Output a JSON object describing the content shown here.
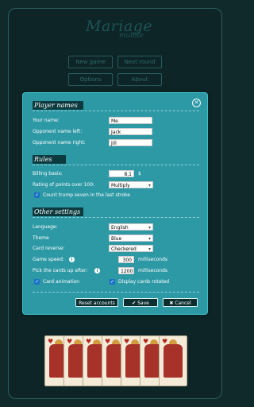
{
  "app": {
    "title": "Mariage",
    "subtitle": "mobile"
  },
  "menu": {
    "new_game": "New game",
    "next_round": "Next round",
    "options": "Options",
    "about": "About"
  },
  "dialog": {
    "close_icon": "close-icon",
    "sections": {
      "player_names": "Player names",
      "rules": "Rules",
      "other_settings": "Other settings"
    },
    "player_names": {
      "your_name_label": "Your name:",
      "your_name_value": "Me",
      "left_label": "Opponent name left:",
      "left_value": "Jack",
      "right_label": "Opponent name right:",
      "right_value": "Jill"
    },
    "rules": {
      "billing_label": "Billing basis:",
      "billing_value": "8,1",
      "billing_unit": "$",
      "rating_label": "Rating of points over 100:",
      "rating_value": "Multiply",
      "count_trump_label": "Count trump seven in the last stroke",
      "count_trump_checked": true
    },
    "other": {
      "language_label": "Language:",
      "language_value": "English",
      "theme_label": "Theme",
      "theme_value": "Blue",
      "card_reverse_label": "Card reverse:",
      "card_reverse_value": "Checkered",
      "game_speed_label": "Game speed:",
      "game_speed_value": "300",
      "game_speed_unit": "milliseconds",
      "pick_cards_label": "Pick the cards up after:",
      "pick_cards_value": "1200",
      "pick_cards_unit": "milliseconds",
      "card_animation_label": "Card animation",
      "display_rotated_label": "Display cards rotated"
    },
    "buttons": {
      "reset": "Reset accounts",
      "save": "✔ Save",
      "cancel": "✖ Cancel"
    }
  },
  "colors": {
    "background": "#102a2c",
    "dialog": "#2d99a5",
    "section_header": "#0b3a3f",
    "checkbox": "#1b70c8"
  }
}
